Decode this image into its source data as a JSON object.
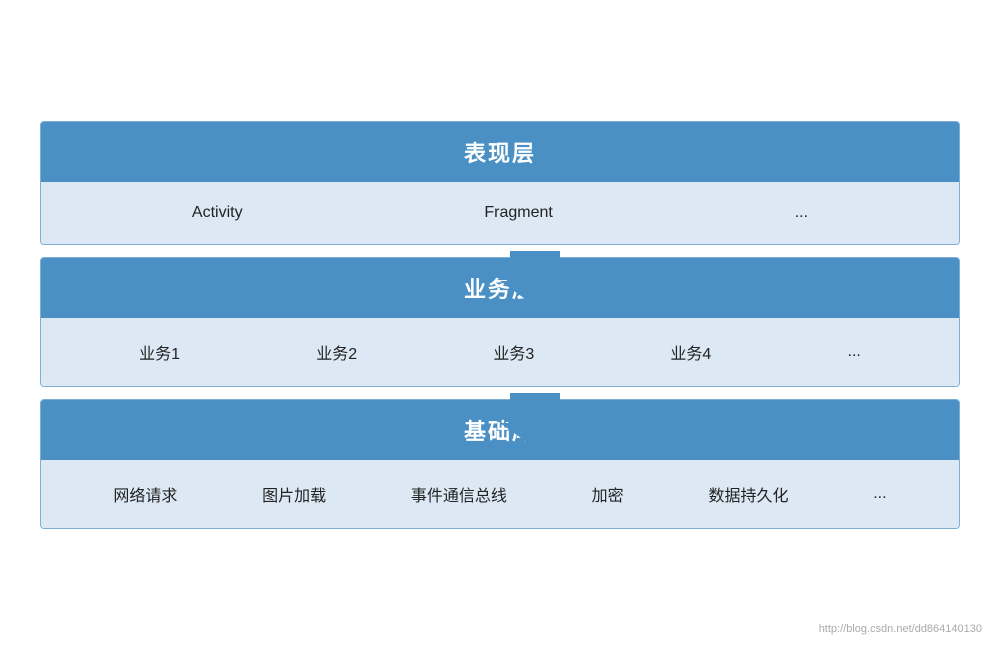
{
  "layers": [
    {
      "id": "presentation",
      "header": "表现层",
      "items": [
        "Activity",
        "Fragment",
        "..."
      ]
    },
    {
      "id": "business",
      "header": "业务层",
      "items": [
        "业务1",
        "业务2",
        "业务3",
        "业务4",
        "..."
      ]
    },
    {
      "id": "foundation",
      "header": "基础库",
      "items": [
        "网络请求",
        "图片加载",
        "事件通信总线",
        "加密",
        "数据持久化",
        "..."
      ]
    }
  ],
  "arrow_color": "#4a90c4",
  "watermark": "http://blog.csdn.net/dd864140130"
}
